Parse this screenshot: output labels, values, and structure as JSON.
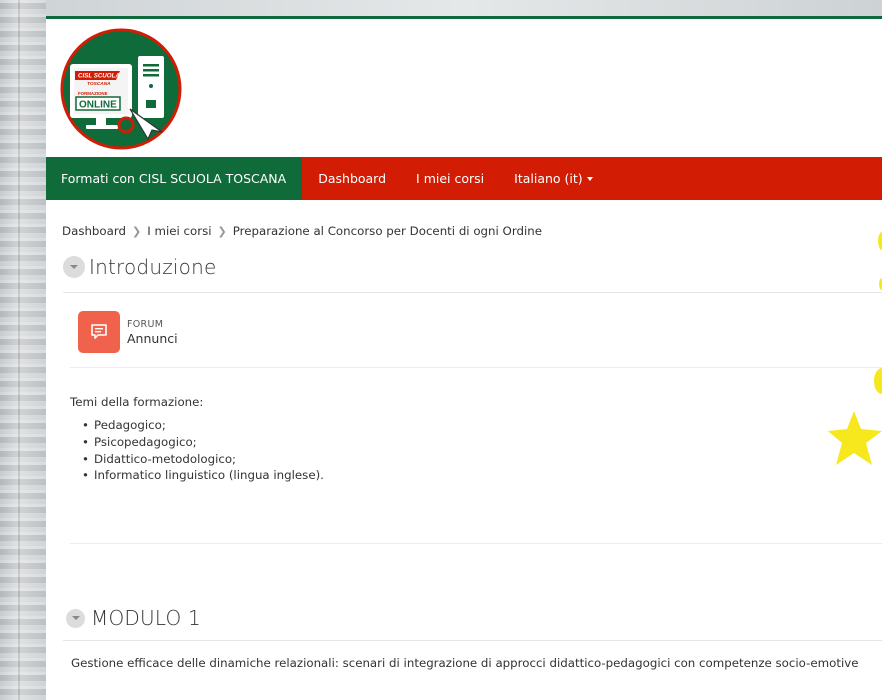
{
  "logo": {
    "line1": "CISL SCUOLA",
    "line2": "TOSCANA",
    "line3": "FORMAZIONE",
    "line4": "ONLINE",
    "icon": "computer-cursor-logo",
    "colors": {
      "circle": "#0f6b3a",
      "red": "#d21c04"
    }
  },
  "navbar": {
    "brand": "Formati con CISL SCUOLA TOSCANA",
    "links": [
      {
        "label": "Dashboard"
      },
      {
        "label": "I miei corsi"
      },
      {
        "label": "Italiano (it)"
      }
    ],
    "colors": {
      "bar": "#d21c04",
      "brand_bg": "#0f6b3a"
    }
  },
  "breadcrumb": [
    "Dashboard",
    "I miei corsi",
    "Preparazione al Concorso per Docenti di ogni Ordine"
  ],
  "sections": [
    {
      "title": "Introduzione",
      "activity": {
        "type": "FORUM",
        "name": "Annunci",
        "icon": "forum-icon"
      },
      "summary_heading": "Temi della formazione:",
      "summary_items": [
        "Pedagogico;",
        "Psicopedagogico;",
        "Didattico-metodologico;",
        "Informatico linguistico (lingua inglese)."
      ]
    },
    {
      "title": "MODULO 1",
      "description": "Gestione efficace delle dinamiche relazionali: scenari di integrazione di approcci didattico-pedagogici con competenze socio-emotive"
    }
  ]
}
